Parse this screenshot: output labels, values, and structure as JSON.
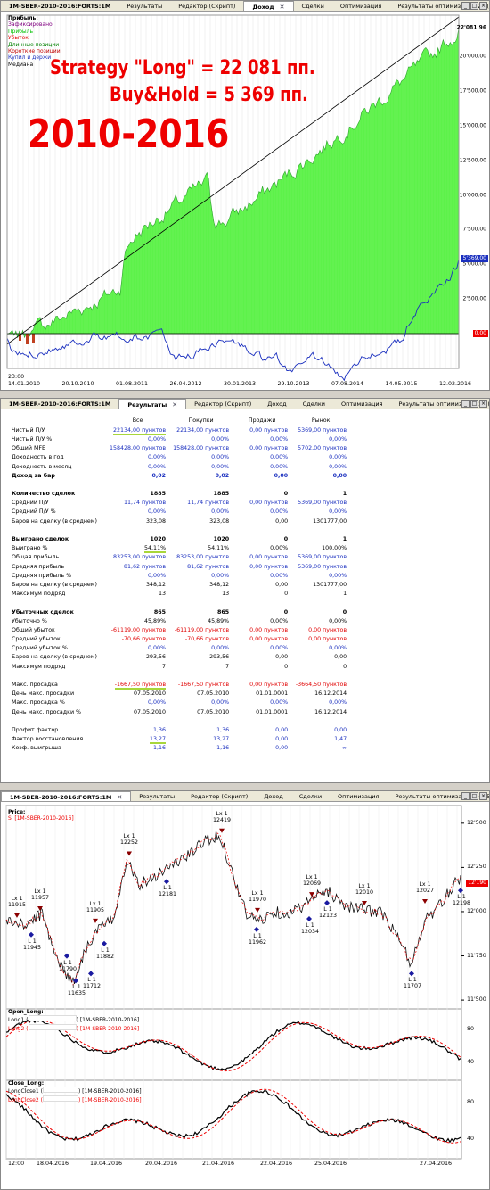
{
  "panel1": {
    "tabs": [
      "1M-SBER-2010-2016:FORTS:1M",
      "Результаты",
      "Редактор (Скрипт)",
      "Доход",
      "Сделки",
      "Оптимизация",
      "Результаты оптимизации 26 (59%)"
    ],
    "active_tab": 3,
    "legend_title": "Прибыль:",
    "legend_items": [
      {
        "label": "Зафиксировано",
        "color": "#800080"
      },
      {
        "label": "Прибыль",
        "color": "#00c000"
      },
      {
        "label": "Убыток",
        "color": "#e00000"
      },
      {
        "label": "Длинные позиции",
        "color": "#008000"
      },
      {
        "label": "Короткие позиции",
        "color": "#c00000"
      },
      {
        "label": "Купил и держи",
        "color": "#1a2fbf"
      },
      {
        "label": "Медиана",
        "color": "#000000"
      }
    ],
    "annotation_1": "Strategy \"Long\" = 22 081 пп.",
    "annotation_2": "Buy&Hold = 5 369 пп.",
    "annotation_3": "2010-2016",
    "y_ticks": [
      "20'000.00",
      "17'500.00",
      "15'000.00",
      "12'500.00",
      "10'000.00",
      "7'500.00",
      "5'000.00",
      "2'500.00"
    ],
    "top_value": "22'081.96",
    "bh_value": "5'369.00",
    "zero_value": "0.00",
    "time_label": "23:00",
    "x_ticks": [
      "14.01.2010",
      "20.10.2010",
      "01.08.2011",
      "26.04.2012",
      "30.01.2013",
      "29.10.2013",
      "07.08.2014",
      "14.05.2015",
      "12.02.2016"
    ]
  },
  "panel2": {
    "tabs": [
      "1M-SBER-2010-2016:FORTS:1M",
      "Результаты",
      "Редактор (Скрипт)",
      "Доход",
      "Сделки",
      "Оптимизация",
      "Результаты оптимизации 26 (59%)"
    ],
    "active_tab": 1,
    "headers": [
      "Все",
      "Покупки",
      "Продажи",
      "Рынок"
    ],
    "rows": [
      {
        "label": "Чистый П/У",
        "vals": [
          "22134,00 пунктов",
          "22134,00 пунктов",
          "0,00 пунктов",
          "5369,00 пунктов"
        ],
        "c": "blue",
        "ul": true
      },
      {
        "label": "Чистый П/У %",
        "vals": [
          "0,00%",
          "0,00%",
          "0,00%",
          "0,00%"
        ],
        "c": "blue"
      },
      {
        "label": "Общий MFE",
        "vals": [
          "158428,00 пунктов",
          "158428,00 пунктов",
          "0,00 пунктов",
          "5702,00 пунктов"
        ],
        "c": "blue"
      },
      {
        "label": "Доходность в год",
        "vals": [
          "0,00%",
          "0,00%",
          "0,00%",
          "0,00%"
        ],
        "c": "blue"
      },
      {
        "label": "Доходность в месяц",
        "vals": [
          "0,00%",
          "0,00%",
          "0,00%",
          "0,00%"
        ],
        "c": "blue"
      },
      {
        "label": "Доход за бар",
        "vals": [
          "0,02",
          "0,02",
          "0,00",
          "0,00"
        ],
        "c": "blue",
        "b": true
      },
      {
        "label": "",
        "vals": [
          "",
          "",
          "",
          ""
        ]
      },
      {
        "label": "Количество сделок",
        "vals": [
          "1885",
          "1885",
          "0",
          "1"
        ],
        "b": true
      },
      {
        "label": "Средний П/У",
        "vals": [
          "11,74 пунктов",
          "11,74 пунктов",
          "0,00 пунктов",
          "5369,00 пунктов"
        ],
        "c": "blue"
      },
      {
        "label": "Средний П/У %",
        "vals": [
          "0,00%",
          "0,00%",
          "0,00%",
          "0,00%"
        ],
        "c": "blue"
      },
      {
        "label": "Баров на сделку (в среднем)",
        "vals": [
          "323,08",
          "323,08",
          "0,00",
          "1301777,00"
        ]
      },
      {
        "label": "",
        "vals": [
          "",
          "",
          "",
          ""
        ]
      },
      {
        "label": "Выиграно сделок",
        "vals": [
          "1020",
          "1020",
          "0",
          "1"
        ],
        "b": true
      },
      {
        "label": "Выиграно %",
        "vals": [
          "54,11%",
          "54,11%",
          "0,00%",
          "100,00%"
        ],
        "ul": true
      },
      {
        "label": "Общая прибыль",
        "vals": [
          "83253,00 пунктов",
          "83253,00 пунктов",
          "0,00 пунктов",
          "5369,00 пунктов"
        ],
        "c": "blue"
      },
      {
        "label": "Средняя прибыль",
        "vals": [
          "81,62 пунктов",
          "81,62 пунктов",
          "0,00 пунктов",
          "5369,00 пунктов"
        ],
        "c": "blue"
      },
      {
        "label": "Средняя прибыль %",
        "vals": [
          "0,00%",
          "0,00%",
          "0,00%",
          "0,00%"
        ],
        "c": "blue"
      },
      {
        "label": "Баров на сделку (в среднем)",
        "vals": [
          "348,12",
          "348,12",
          "0,00",
          "1301777,00"
        ]
      },
      {
        "label": "Максимум подряд",
        "vals": [
          "13",
          "13",
          "0",
          "1"
        ]
      },
      {
        "label": "",
        "vals": [
          "",
          "",
          "",
          ""
        ]
      },
      {
        "label": "Убыточных сделок",
        "vals": [
          "865",
          "865",
          "0",
          "0"
        ],
        "b": true
      },
      {
        "label": "Убыточно %",
        "vals": [
          "45,89%",
          "45,89%",
          "0,00%",
          "0,00%"
        ]
      },
      {
        "label": "Общий убыток",
        "vals": [
          "-61119,00 пунктов",
          "-61119,00 пунктов",
          "0,00 пунктов",
          "0,00 пунктов"
        ],
        "c": "red"
      },
      {
        "label": "Средний убыток",
        "vals": [
          "-70,66 пунктов",
          "-70,66 пунктов",
          "0,00 пунктов",
          "0,00 пунктов"
        ],
        "c": "red"
      },
      {
        "label": "Средний убыток %",
        "vals": [
          "0,00%",
          "0,00%",
          "0,00%",
          "0,00%"
        ],
        "c": "blue"
      },
      {
        "label": "Баров на сделку (в среднем)",
        "vals": [
          "293,56",
          "293,56",
          "0,00",
          "0,00"
        ]
      },
      {
        "label": "Максимум подряд",
        "vals": [
          "7",
          "7",
          "0",
          "0"
        ]
      },
      {
        "label": "",
        "vals": [
          "",
          "",
          "",
          ""
        ]
      },
      {
        "label": "Макс. просадка",
        "vals": [
          "-1667,50 пунктов",
          "-1667,50 пунктов",
          "0,00 пунктов",
          "-3664,50 пунктов"
        ],
        "c": "red",
        "ul": true
      },
      {
        "label": "День макс. просадки",
        "vals": [
          "07.05.2010",
          "07.05.2010",
          "01.01.0001",
          "16.12.2014"
        ]
      },
      {
        "label": "Макс. просадка %",
        "vals": [
          "0,00%",
          "0,00%",
          "0,00%",
          "0,00%"
        ],
        "c": "blue"
      },
      {
        "label": "День макс. просадки %",
        "vals": [
          "07.05.2010",
          "07.05.2010",
          "01.01.0001",
          "16.12.2014"
        ]
      },
      {
        "label": "",
        "vals": [
          "",
          "",
          "",
          ""
        ]
      },
      {
        "label": "Профит фактор",
        "vals": [
          "1,36",
          "1,36",
          "0,00",
          "0,00"
        ],
        "c": "blue"
      },
      {
        "label": "Фактор восстановления",
        "vals": [
          "13,27",
          "13,27",
          "0,00",
          "1,47"
        ],
        "c": "blue",
        "ul": true
      },
      {
        "label": "Коэф. выигрыша",
        "vals": [
          "1,16",
          "1,16",
          "0,00",
          "∞"
        ],
        "c": "blue"
      }
    ]
  },
  "panel3": {
    "tabs": [
      "1M-SBER-2010-2016:FORTS:1M",
      "Результаты",
      "Редактор (Скрипт)",
      "Доход",
      "Сделки",
      "Оптимизация",
      "Результаты оптимизации 26 (59%)"
    ],
    "active_tab": 0,
    "price_title": "Price:",
    "price_sub": "Si [1M-SBER-2010-2016]",
    "price_ticks": [
      "12'500",
      "12'250",
      "12'000",
      "11'750",
      "11'500"
    ],
    "last_price": "12'190",
    "open_title": "Open_Long:",
    "open_l1": "Long1 (",
    "open_l2": "Long2 (",
    "open_sfx": ") [1M-SBER-2010-2016]",
    "open_ticks": [
      "80",
      "40"
    ],
    "close_title": "Close_Long:",
    "close_l1": "LongClose1 (",
    "close_l2": "LongClose2 (",
    "close_sfx": ") [1M-SBER-2010-2016]",
    "close_ticks": [
      "80",
      "40"
    ],
    "time_label": "12:00",
    "x_ticks": [
      "18.04.2016",
      "19.04.2016",
      "20.04.2016",
      "21.04.2016",
      "22.04.2016",
      "25.04.2016",
      "27.04.2016"
    ],
    "trades": [
      {
        "lbl": "Lx 1",
        "val": "11915",
        "type": "lx"
      },
      {
        "lbl": "Lx 1",
        "val": "11957",
        "type": "lx"
      },
      {
        "lbl": "L 1",
        "val": "11945",
        "type": "l"
      },
      {
        "lbl": "L 1",
        "val": "11635",
        "type": "l"
      },
      {
        "lbl": "L 1",
        "val": "11790",
        "type": "l"
      },
      {
        "lbl": "L 1",
        "val": "11712",
        "type": "l"
      },
      {
        "lbl": "Lx 1",
        "val": "11905",
        "type": "lx"
      },
      {
        "lbl": "L 1",
        "val": "11882",
        "type": "l"
      },
      {
        "lbl": "Lx 1",
        "val": "12252",
        "type": "lx"
      },
      {
        "lbl": "L 1",
        "val": "12181",
        "type": "l"
      },
      {
        "lbl": "Lx 1",
        "val": "12419",
        "type": "lx"
      },
      {
        "lbl": "Lx 1",
        "val": "11970",
        "type": "lx"
      },
      {
        "lbl": "L 1",
        "val": "11962",
        "type": "l"
      },
      {
        "lbl": "Lx 1",
        "val": "12069",
        "type": "lx"
      },
      {
        "lbl": "L 1",
        "val": "12034",
        "type": "l"
      },
      {
        "lbl": "L 1",
        "val": "12123",
        "type": "l"
      },
      {
        "lbl": "Lx 1",
        "val": "12010",
        "type": "lx"
      },
      {
        "lbl": "L 1",
        "val": "11707",
        "type": "l"
      },
      {
        "lbl": "Lx 1",
        "val": "12027",
        "type": "lx"
      },
      {
        "lbl": "L 1",
        "val": "12198",
        "type": "l"
      }
    ]
  }
}
